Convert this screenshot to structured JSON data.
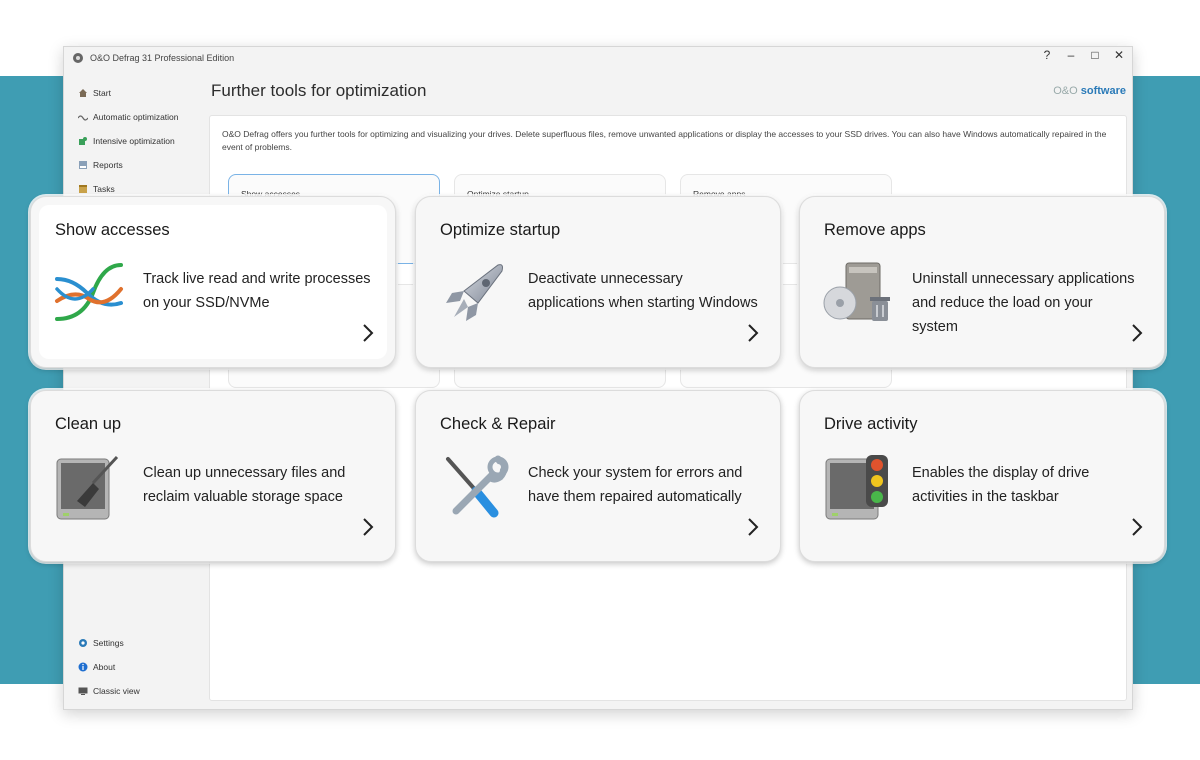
{
  "window": {
    "title": "O&O Defrag 31 Professional Edition",
    "controls": [
      "?",
      "–",
      "□",
      "✕"
    ]
  },
  "sidebar": {
    "items": [
      {
        "label": "Start",
        "icon": "house-icon"
      },
      {
        "label": "Automatic optimization",
        "icon": "wave-icon"
      },
      {
        "label": "Intensive optimization",
        "icon": "puzzle-icon"
      },
      {
        "label": "Reports",
        "icon": "report-icon"
      },
      {
        "label": "Tasks",
        "icon": "tasks-icon"
      }
    ],
    "bottom_items": [
      {
        "label": "Settings",
        "icon": "gear-icon"
      },
      {
        "label": "About",
        "icon": "info-icon"
      },
      {
        "label": "Classic view",
        "icon": "monitor-icon"
      }
    ]
  },
  "main": {
    "title": "Further tools for optimization",
    "brand_prefix": "O&O",
    "brand_suffix": "software",
    "intro": "O&O Defrag offers you further tools for optimizing and visualizing your drives. Delete superfluous files, remove unwanted applications or display the accesses to your SSD drives. You can also have Windows automatically repaired in the event of problems.",
    "ghost_cards": [
      "Show accesses",
      "Optimize startup",
      "Remove apps"
    ]
  },
  "cards": [
    {
      "title": "Show accesses",
      "description": "Track live read and write processes on your SSD/NVMe",
      "icon": "access-graph-icon"
    },
    {
      "title": "Optimize startup",
      "description": "Deactivate unnecessary applications when starting Windows",
      "icon": "rocket-icon"
    },
    {
      "title": "Remove apps",
      "description": "Uninstall unnecessary applications and reduce the load on your system",
      "icon": "uninstall-icon"
    },
    {
      "title": "Clean up",
      "description": "Clean up unnecessary files and reclaim valuable storage space",
      "icon": "broom-drive-icon"
    },
    {
      "title": "Check & Repair",
      "description": "Check your system for errors and have them repaired automatically",
      "icon": "wrench-screwdriver-icon"
    },
    {
      "title": "Drive activity",
      "description": "Enables the display of drive activities in the taskbar",
      "icon": "traffic-light-drive-icon"
    }
  ],
  "colors": {
    "backdrop": "#3f9db3",
    "brand": "#2a7ab8",
    "selected_border": "#7ab3e6"
  }
}
